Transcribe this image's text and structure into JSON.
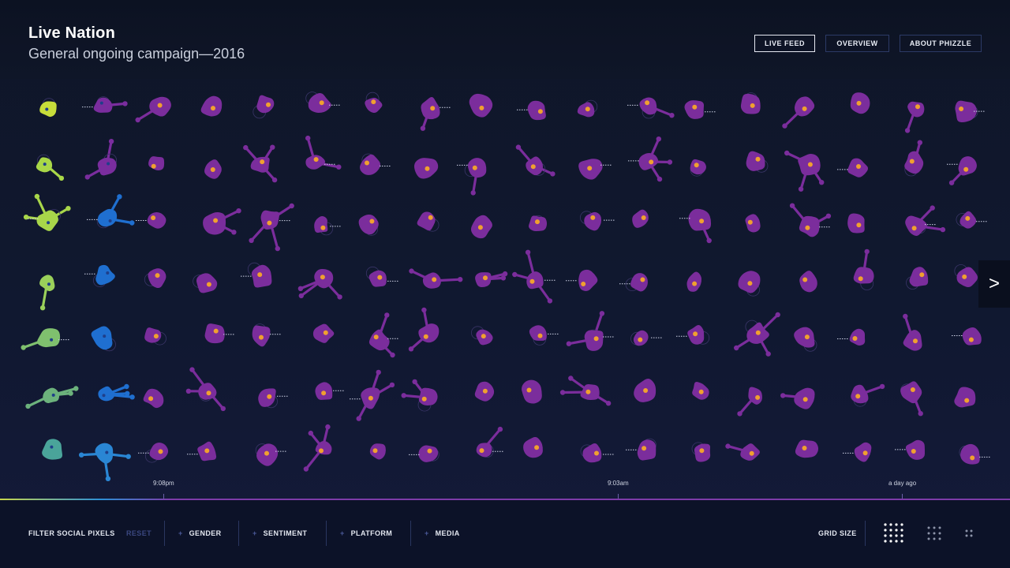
{
  "header": {
    "title": "Live Nation",
    "subtitle": "General ongoing campaign—2016",
    "nav": [
      {
        "label": "LIVE FEED",
        "active": true
      },
      {
        "label": "OVERVIEW",
        "active": false
      },
      {
        "label": "ABOUT PHIZZLE",
        "active": false
      }
    ]
  },
  "timeline": {
    "ticks": [
      {
        "label": "9:08pm"
      },
      {
        "label": "9:03am"
      },
      {
        "label": "a day ago"
      }
    ]
  },
  "grid": {
    "columns": 18,
    "rows": 7
  },
  "next_icon": ">",
  "footer": {
    "filter_label": "FILTER SOCIAL PIXELS",
    "reset_label": "RESET",
    "filters": [
      {
        "plus": "+",
        "label": "GENDER"
      },
      {
        "plus": "+",
        "label": "SENTIMENT"
      },
      {
        "plus": "+",
        "label": "PLATFORM"
      },
      {
        "plus": "+",
        "label": "MEDIA"
      }
    ],
    "grid_size_label": "GRID SIZE"
  },
  "colors": {
    "pixel_default": "#7b2d9c",
    "pixel_dot": "#f0a030",
    "col0": [
      "#c7dd3a",
      "#a9d848",
      "#a8d64a",
      "#9ad05a",
      "#7fc06e",
      "#6cb27c",
      "#4aa49a"
    ],
    "col1": [
      "#7a2d9e",
      "#7a2d9e",
      "#1f6fd0",
      "#1f6fd0",
      "#1f6fd0",
      "#1f6fd0",
      "#2a86d4"
    ]
  }
}
